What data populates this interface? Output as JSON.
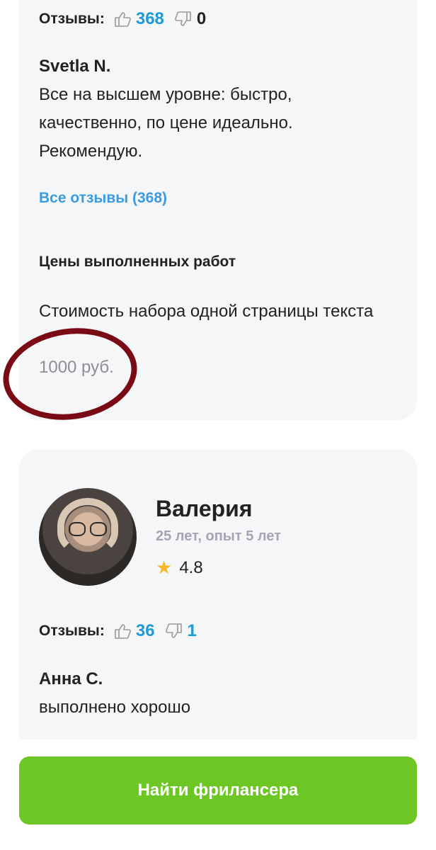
{
  "freelancer1": {
    "reviews_label": "Отзывы:",
    "likes": "368",
    "dislikes": "0",
    "review_author": "Svetla N.",
    "review_text": "Все на высшем уровне: быстро, качественно, по цене идеально. Рекомендую.",
    "all_reviews_link": "Все отзывы (368)",
    "prices_title": "Цены выполненных работ",
    "price_item": "Стоимость набора одной страницы текста",
    "price_value": "1000 руб."
  },
  "freelancer2": {
    "name": "Валерия",
    "meta": "25 лет, опыт 5 лет",
    "rating": "4.8",
    "reviews_label": "Отзывы:",
    "likes": "36",
    "dislikes": "1",
    "review_author": "Анна С.",
    "review_text": "выполнено хорошо"
  },
  "cta_label": "Найти фрилансера",
  "colors": {
    "accent_blue": "#1e9bd7",
    "link_blue": "#3a9be0",
    "cta_green": "#6cc624",
    "annotation_circle": "#7a0a14"
  }
}
